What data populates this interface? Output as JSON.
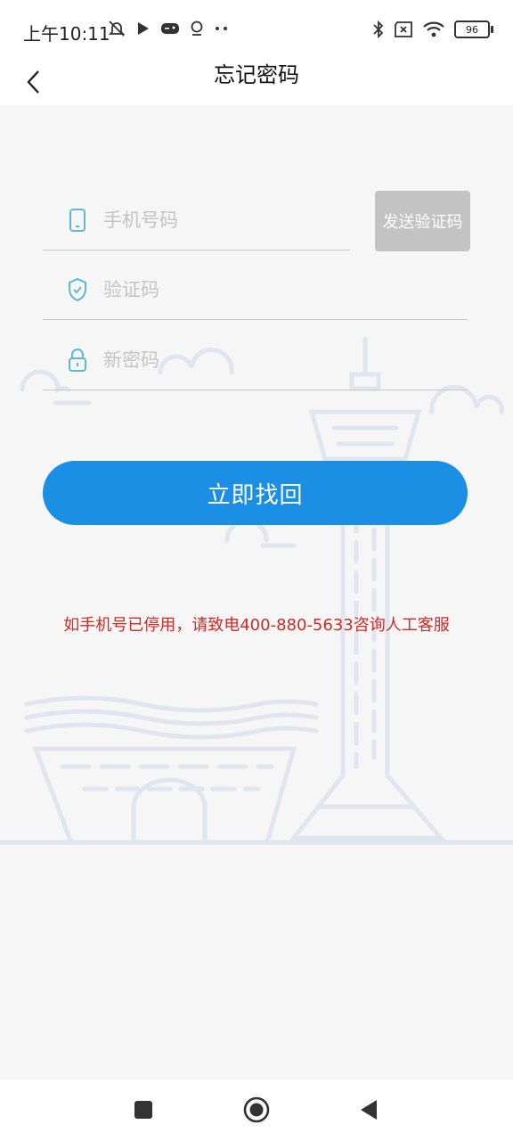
{
  "status_bar": {
    "time": "上午10:11",
    "battery": "96"
  },
  "header": {
    "title": "忘记密码"
  },
  "form": {
    "phone_placeholder": "手机号码",
    "code_placeholder": "验证码",
    "password_placeholder": "新密码",
    "send_code_label": "发送验证码",
    "submit_label": "立即找回"
  },
  "hint": {
    "text": "如手机号已停用，请致电400-880-5633咨询人工客服"
  },
  "colors": {
    "accent": "#1a8fe3",
    "hint": "#d12b27",
    "disabled": "#c3c3c3",
    "icon": "#5cb8d6"
  },
  "icons": [
    "back-arrow-icon",
    "phone-icon",
    "shield-check-icon",
    "lock-icon",
    "nav-square-icon",
    "nav-home-icon",
    "nav-back-icon"
  ]
}
